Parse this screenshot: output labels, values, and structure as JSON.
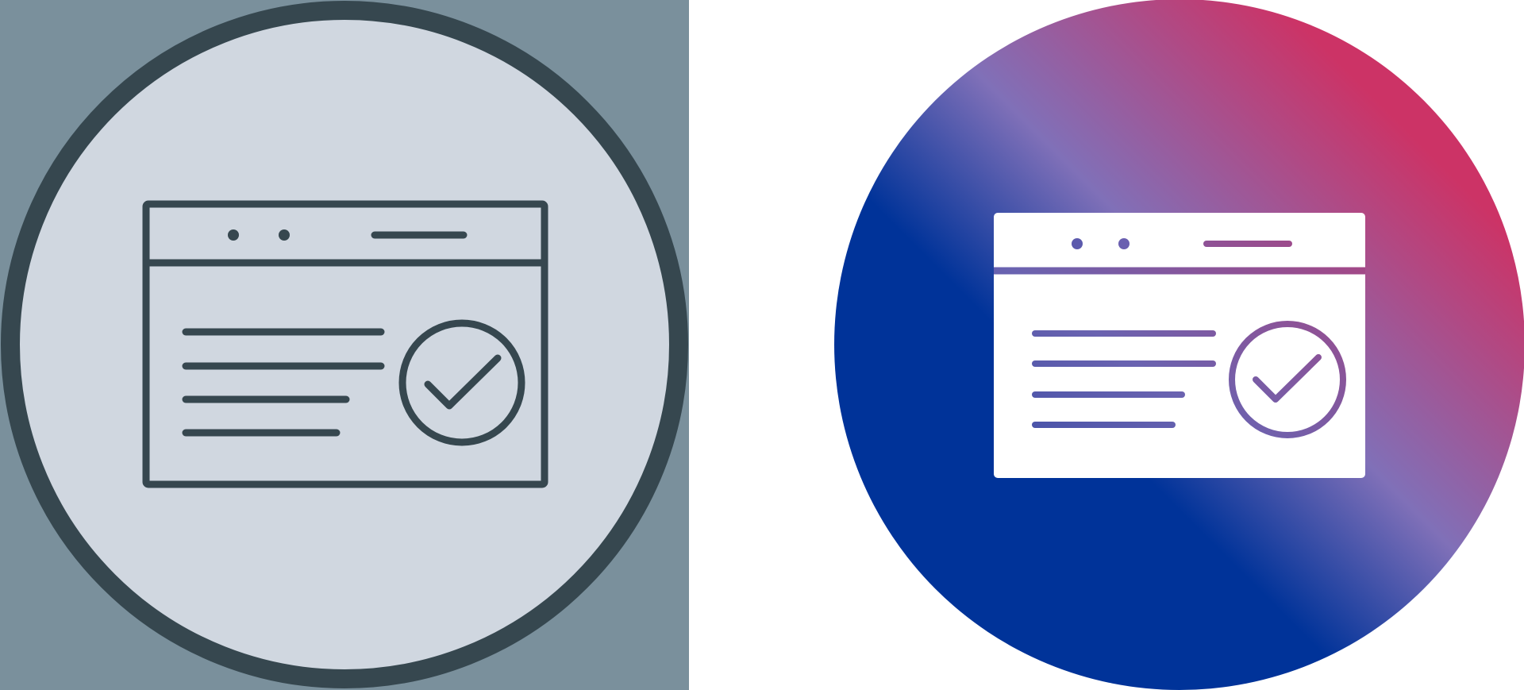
{
  "icons": [
    {
      "name": "browser-check-icon-outline",
      "style": "outline",
      "colors": {
        "background": "#7a909c",
        "circle_fill": "#d0d7e0",
        "stroke": "#36474f"
      }
    },
    {
      "name": "browser-check-icon-gradient",
      "style": "gradient-filled",
      "colors": {
        "gradient_start": "#003399",
        "gradient_mid": "#8070b8",
        "gradient_end": "#cc3366",
        "window_fill": "#ffffff"
      }
    }
  ]
}
